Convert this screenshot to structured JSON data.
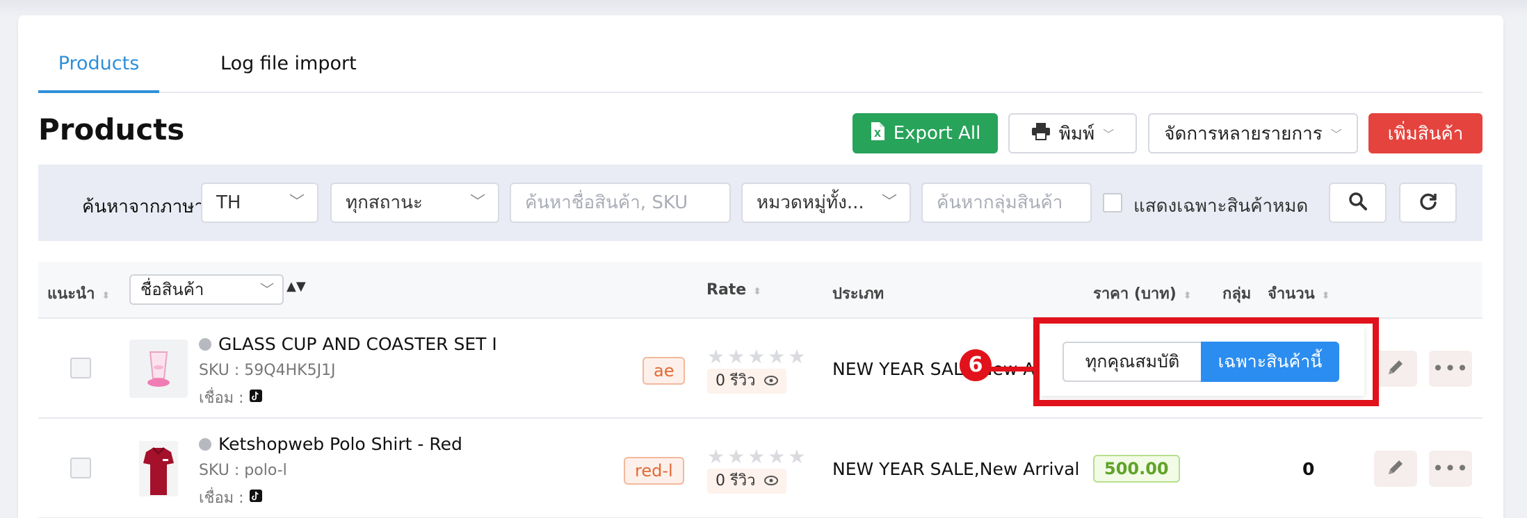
{
  "tabs": [
    {
      "label": "Products",
      "active": true
    },
    {
      "label": "Log file import",
      "active": false
    }
  ],
  "page_title": "Products",
  "toolbar": {
    "export_label": "Export All",
    "print_label": "พิมพ์",
    "bulk_label": "จัดการหลายรายการ",
    "add_label": "เพิ่มสินค้า"
  },
  "filters": {
    "search_language_label": "ค้นหาจากภาษา",
    "language_value": "TH",
    "status_value": "ทุกสถานะ",
    "name_sku_placeholder": "ค้นหาชื่อสินค้า, SKU",
    "category_value": "หมวดหมู่ทั้ง...",
    "group_placeholder": "ค้นหากลุ่มสินค้า",
    "out_of_stock_label": "แสดงเฉพาะสินค้าหมด"
  },
  "table": {
    "headers": {
      "recommend": "แนะนำ",
      "name_select": "ชื่อสินค้า",
      "rate": "Rate",
      "category": "ประเภท",
      "price": "ราคา (บาท)",
      "group": "กลุ่ม",
      "quantity": "จำนวน"
    },
    "rows": [
      {
        "name": "GLASS CUP AND COASTER SET I",
        "sku": "SKU : 59Q4HK5J1J",
        "link_label": "เชื่อม :",
        "tag": "ae",
        "reviews": "0 รีวิว",
        "category": "NEW YEAR SALE,New Arri",
        "price": "",
        "quantity": ""
      },
      {
        "name": "Ketshopweb Polo Shirt - Red",
        "sku": "SKU : polo-l",
        "link_label": "เชื่อม :",
        "tag": "red-l",
        "reviews": "0 รีวิว",
        "category": "NEW YEAR SALE,New Arrival",
        "price": "500.00",
        "quantity": "0"
      }
    ]
  },
  "popover": {
    "all_attributes_label": "ทุกคุณสมบัติ",
    "this_product_only_label": "เฉพาะสินค้านี้",
    "step_number": "6"
  },
  "colors": {
    "tab_active": "#2f8fd8",
    "export_green": "#27a35a",
    "add_red": "#e4443d",
    "segment_blue": "#2b8df0",
    "annotation_red": "#e1121b",
    "price_green": "#5fa328"
  }
}
